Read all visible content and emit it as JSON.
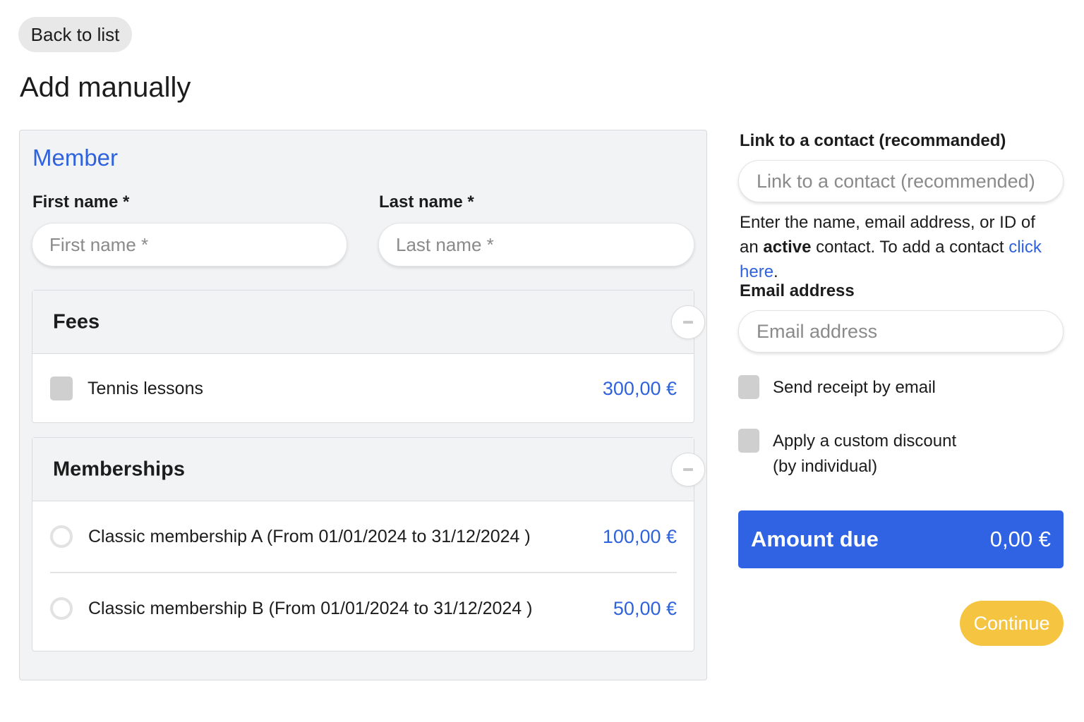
{
  "nav": {
    "back_label": "Back to list"
  },
  "page": {
    "title": "Add manually"
  },
  "member": {
    "section_title": "Member",
    "first_name": {
      "label": "First name *",
      "placeholder": "First name *",
      "value": ""
    },
    "last_name": {
      "label": "Last name *",
      "placeholder": "Last name *",
      "value": ""
    }
  },
  "fees": {
    "title": "Fees",
    "items": [
      {
        "label": "Tennis lessons",
        "price": "300,00 €",
        "checked": false
      }
    ]
  },
  "memberships": {
    "title": "Memberships",
    "items": [
      {
        "label": "Classic membership A (From 01/01/2024 to 31/12/2024 )",
        "price": "100,00 €",
        "selected": false
      },
      {
        "label": "Classic membership B (From 01/01/2024 to 31/12/2024 )",
        "price": "50,00 €",
        "selected": false
      }
    ]
  },
  "contact": {
    "label": "Link to a contact (recommanded)",
    "placeholder": "Link to a contact (recommended)",
    "help_prefix": "Enter the name, email address, or ID of an ",
    "help_bold": "active",
    "help_middle": " contact. To add a contact ",
    "help_link": "click here",
    "help_suffix": "."
  },
  "email": {
    "label": "Email address",
    "placeholder": "Email address",
    "value": ""
  },
  "options": {
    "send_receipt": "Send receipt by email",
    "custom_discount": "Apply a custom discount (by individual)"
  },
  "summary": {
    "amount_label": "Amount due",
    "amount_value": "0,00 €"
  },
  "actions": {
    "continue_label": "Continue"
  },
  "colors": {
    "accent": "#2f62dd",
    "amount_bg": "#2f63e4",
    "continue_bg": "#f5c542"
  },
  "icons": {
    "collapse": "minus-icon"
  }
}
